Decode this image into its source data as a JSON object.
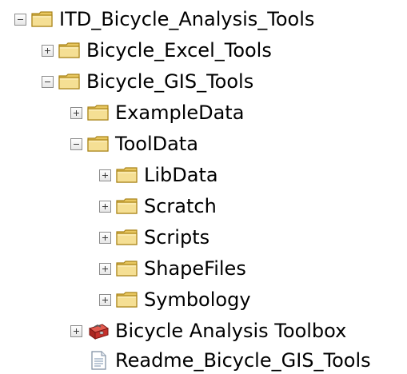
{
  "tree": {
    "root": {
      "label": "ITD_Bicycle_Analysis_Tools",
      "expanded": true,
      "icon": "folder-icon"
    },
    "excel_tools": {
      "label": "Bicycle_Excel_Tools",
      "expanded": false,
      "icon": "folder-icon"
    },
    "gis_tools": {
      "label": "Bicycle_GIS_Tools",
      "expanded": true,
      "icon": "folder-icon"
    },
    "example_data": {
      "label": "ExampleData",
      "expanded": false,
      "icon": "folder-icon"
    },
    "tool_data": {
      "label": "ToolData",
      "expanded": true,
      "icon": "folder-icon"
    },
    "lib_data": {
      "label": "LibData",
      "expanded": false,
      "icon": "folder-icon"
    },
    "scratch": {
      "label": "Scratch",
      "expanded": false,
      "icon": "folder-icon"
    },
    "scripts": {
      "label": "Scripts",
      "expanded": false,
      "icon": "folder-icon"
    },
    "shape_files": {
      "label": "ShapeFiles",
      "expanded": false,
      "icon": "folder-icon"
    },
    "symbology": {
      "label": "Symbology",
      "expanded": false,
      "icon": "folder-icon"
    },
    "toolbox": {
      "label": "Bicycle Analysis Toolbox",
      "expanded": false,
      "icon": "toolbox-icon"
    },
    "readme": {
      "label": "Readme_Bicycle_GIS_Tools",
      "icon": "document-icon"
    }
  },
  "colors": {
    "folder_body": "#e8c760",
    "folder_front": "#f5df94",
    "folder_outline": "#a98318",
    "toolbox_red": "#c4302b"
  }
}
